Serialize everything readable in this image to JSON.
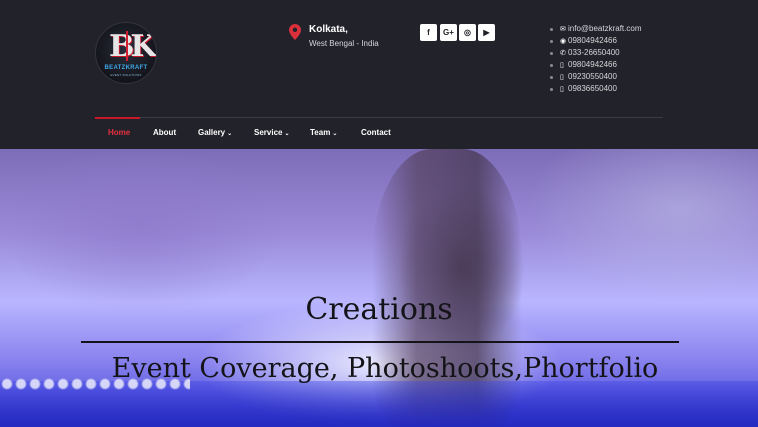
{
  "brand": {
    "logo_name": "BEATZKRAFT",
    "logo_tagline": "EVENT SOLUTIONS",
    "logo_mark": "BK"
  },
  "location": {
    "city": "Kolkata,",
    "region": "West Bengal - India",
    "icon": "map-pin-icon"
  },
  "social": [
    {
      "name": "facebook-icon",
      "glyph": "f"
    },
    {
      "name": "google-plus-icon",
      "glyph": "G+"
    },
    {
      "name": "instagram-icon",
      "glyph": "◎"
    },
    {
      "name": "youtube-icon",
      "glyph": "▶"
    }
  ],
  "contacts": [
    {
      "icon": "envelope-icon",
      "glyph": "✉",
      "text": "info@beatzkraft.com"
    },
    {
      "icon": "whatsapp-icon",
      "glyph": "◉",
      "text": "09804942466"
    },
    {
      "icon": "phone-icon",
      "glyph": "✆",
      "text": "033-26650400"
    },
    {
      "icon": "mobile-icon",
      "glyph": "▯",
      "text": "09804942466"
    },
    {
      "icon": "mobile-icon",
      "glyph": "▯",
      "text": "09230550400"
    },
    {
      "icon": "mobile-icon",
      "glyph": "▯",
      "text": "09836650400"
    }
  ],
  "nav": {
    "items": [
      {
        "label": "Home",
        "active": true
      },
      {
        "label": "About"
      },
      {
        "label": "Gallery",
        "dropdown": true
      },
      {
        "label": "Service",
        "dropdown": true
      },
      {
        "label": "Team",
        "dropdown": true
      },
      {
        "label": "Contact"
      }
    ],
    "caret": "⌄"
  },
  "hero": {
    "title": "Creations",
    "subtitle": "Event Coverage, Photoshoots,Phortfolio"
  },
  "colors": {
    "accent": "#c8192b",
    "header_bg": "#22222a",
    "pin": "#d9303c"
  }
}
